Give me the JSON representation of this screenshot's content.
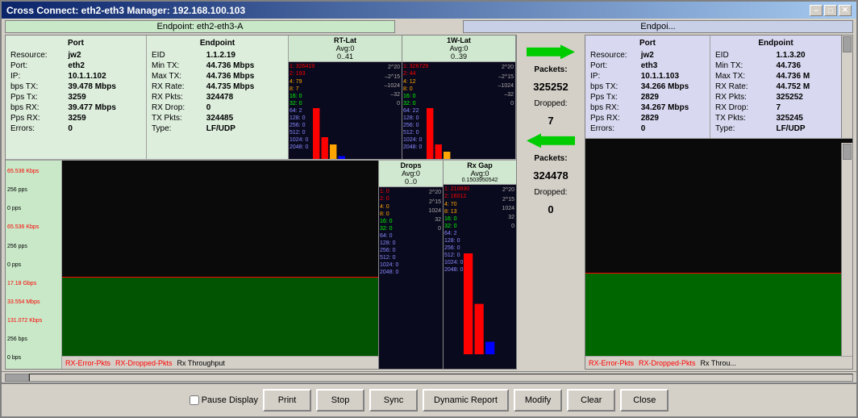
{
  "window": {
    "title": "Cross Connect: eth2-eth3  Manager: 192.168.100.103",
    "title_btn_min": "−",
    "title_btn_max": "□",
    "title_btn_close": "✕"
  },
  "endpoint_a": {
    "label": "Endpoint: eth2-eth3-A"
  },
  "endpoint_b": {
    "label": "Endpoi..."
  },
  "left_port": {
    "section_label": "Port",
    "resource_label": "Resource:",
    "resource_value": "jw2",
    "port_label": "Port:",
    "port_value": "eth2",
    "ip_label": "IP:",
    "ip_value": "10.1.1.102",
    "bps_tx_label": "bps TX:",
    "bps_tx_value": "39.478 Mbps",
    "pps_tx_label": "Pps Tx:",
    "pps_tx_value": "3259",
    "bps_rx_label": "bps RX:",
    "bps_rx_value": "39.477 Mbps",
    "pps_rx_label": "Pps RX:",
    "pps_rx_value": "3259",
    "errors_label": "Errors:",
    "errors_value": "0"
  },
  "left_endpoint": {
    "section_label": "Endpoint",
    "eid_label": "EID",
    "eid_value": "1.1.2.19",
    "min_tx_label": "Min TX:",
    "min_tx_value": "44.736 Mbps",
    "max_tx_label": "Max TX:",
    "max_tx_value": "44.736 Mbps",
    "rx_rate_label": "RX Rate:",
    "rx_rate_value": "44.735 Mbps",
    "rx_pkts_label": "RX Pkts:",
    "rx_pkts_value": "324478",
    "rx_drop_label": "RX Drop:",
    "rx_drop_value": "0",
    "tx_pkts_label": "TX Pkts:",
    "tx_pkts_value": "324485",
    "type_label": "Type:",
    "type_value": "LF/UDP"
  },
  "rt_lat": {
    "header": "RT-Lat",
    "avg_label": "Avg:0",
    "range": "0..41",
    "stats": [
      {
        "val": "1: 326419",
        "color": "red"
      },
      {
        "val": "2: 193",
        "color": "red"
      },
      {
        "val": "4: 79",
        "color": "orange"
      },
      {
        "val": "8: 7",
        "color": "orange"
      },
      {
        "val": "16: 0",
        "color": "green"
      },
      {
        "val": "32: 0",
        "color": "green"
      },
      {
        "val": "64: 2",
        "color": "blue"
      },
      {
        "val": "128: 0",
        "color": "blue"
      },
      {
        "val": "256: 0",
        "color": "blue"
      },
      {
        "val": "512: 0",
        "color": "blue"
      },
      {
        "val": "1024: 0",
        "color": "blue"
      },
      {
        "val": "2048: 0",
        "color": "blue"
      }
    ]
  },
  "one_w_lat": {
    "header": "1W-Lat",
    "avg_label": "Avg:0",
    "range": "0..39",
    "stats": [
      {
        "val": "1: 326729",
        "color": "red"
      },
      {
        "val": "2: 44",
        "color": "red"
      },
      {
        "val": "4: 12",
        "color": "orange"
      },
      {
        "val": "8: 0",
        "color": "orange"
      },
      {
        "val": "16: 0",
        "color": "green"
      },
      {
        "val": "32: 0",
        "color": "green"
      },
      {
        "val": "64: 22",
        "color": "blue"
      },
      {
        "val": "128: 0",
        "color": "blue"
      },
      {
        "val": "256: 0",
        "color": "blue"
      },
      {
        "val": "512: 0",
        "color": "blue"
      },
      {
        "val": "1024: 0",
        "color": "blue"
      },
      {
        "val": "2048: 0",
        "color": "blue"
      }
    ]
  },
  "drops": {
    "header": "Drops",
    "avg_label": "Avg:0",
    "range": "0..0",
    "stats": [
      {
        "val": "1: 0",
        "color": "red"
      },
      {
        "val": "2: 0",
        "color": "red"
      },
      {
        "val": "4: 0",
        "color": "orange"
      },
      {
        "val": "8: 0",
        "color": "orange"
      },
      {
        "val": "16: 0",
        "color": "green"
      },
      {
        "val": "32: 0",
        "color": "green"
      },
      {
        "val": "64: 0",
        "color": "blue"
      },
      {
        "val": "128: 0",
        "color": "blue"
      },
      {
        "val": "256: 0",
        "color": "blue"
      },
      {
        "val": "512: 0",
        "color": "blue"
      },
      {
        "val": "1024: 0",
        "color": "blue"
      },
      {
        "val": "2048: 0",
        "color": "blue"
      }
    ]
  },
  "rx_gap": {
    "header": "Rx Gap",
    "avg_label": "Avg:0",
    "range": "0.1503950542",
    "stats": [
      {
        "val": "1: 210690",
        "color": "red"
      },
      {
        "val": "2: 16012",
        "color": "red"
      },
      {
        "val": "4: 70",
        "color": "orange"
      },
      {
        "val": "8: 13",
        "color": "orange"
      },
      {
        "val": "16: 0",
        "color": "green"
      },
      {
        "val": "32: 0",
        "color": "green"
      },
      {
        "val": "64: 2",
        "color": "blue"
      },
      {
        "val": "128: 0",
        "color": "blue"
      },
      {
        "val": "256: 0",
        "color": "blue"
      },
      {
        "val": "512: 0",
        "color": "blue"
      },
      {
        "val": "1024: 0",
        "color": "blue"
      },
      {
        "val": "2048: 0",
        "color": "blue"
      }
    ]
  },
  "middle": {
    "packets_label": "Packets:",
    "packets_value": "325252",
    "dropped_label": "Dropped:",
    "dropped_value": "7",
    "packets2_label": "Packets:",
    "packets2_value": "324478",
    "dropped2_label": "Dropped:",
    "dropped2_value": "0"
  },
  "right_port": {
    "section_label": "Port",
    "resource_label": "Resource:",
    "resource_value": "jw2",
    "port_label": "Port:",
    "port_value": "eth3",
    "ip_label": "IP:",
    "ip_value": "10.1.1.103",
    "bps_tx_label": "bps TX:",
    "bps_tx_value": "34.266 Mbps",
    "pps_tx_label": "Pps Tx:",
    "pps_tx_value": "2829",
    "bps_rx_label": "bps RX:",
    "bps_rx_value": "34.267 Mbps",
    "pps_rx_label": "Pps RX:",
    "pps_rx_value": "2829",
    "errors_label": "Errors:",
    "errors_value": "0"
  },
  "right_endpoint": {
    "section_label": "Endpoint",
    "eid_label": "EID",
    "eid_value": "1.1.3.20",
    "min_tx_label": "Min TX:",
    "min_tx_value": "44.736",
    "max_tx_label": "Max TX:",
    "max_tx_value": "44.736 M",
    "rx_rate_label": "RX Rate:",
    "rx_rate_value": "44.752 M",
    "rx_pkts_label": "RX Pkts:",
    "rx_pkts_value": "325252",
    "rx_drop_label": "RX Drop:",
    "rx_drop_value": "7",
    "tx_pkts_label": "TX Pkts:",
    "tx_pkts_value": "325245",
    "type_label": "Type:",
    "type_value": "LF/UDP"
  },
  "bottom_tabs_left": [
    {
      "label": "RX-Error-Pkts",
      "color": "red"
    },
    {
      "label": "RX-Dropped-Pkts",
      "color": "red"
    },
    {
      "label": "Rx Throughput",
      "color": "black"
    }
  ],
  "bottom_tabs_right": [
    {
      "label": "RX-Error-Pkts",
      "color": "red"
    },
    {
      "label": "RX-Dropped-Pkts",
      "color": "red"
    },
    {
      "label": "Rx Throu...",
      "color": "black"
    }
  ],
  "buttons": {
    "pause_display": "Pause Display",
    "print": "Print",
    "stop": "Stop",
    "sync": "Sync",
    "dynamic_report": "Dynamic Report",
    "modify": "Modify",
    "clear": "Clear",
    "close": "Close"
  },
  "graph_scales": {
    "left_scale": [
      "2^20",
      "2^15",
      "1024",
      "32",
      "0"
    ],
    "right_scale": [
      "2^20",
      "2^15",
      "1024",
      "32",
      "0"
    ]
  },
  "left_side_stats": {
    "s1": "65.536 Kbps",
    "s2": "256 pps",
    "s3": "0 pps",
    "s4": "65.536 Kbps",
    "s5": "256 pps",
    "s6": "0 pps",
    "s7": "17.18 Gbps",
    "s8": "33.554 Mbps",
    "s9": "131.072 Kbps",
    "s10": "256 bps",
    "s11": "0 bps"
  }
}
